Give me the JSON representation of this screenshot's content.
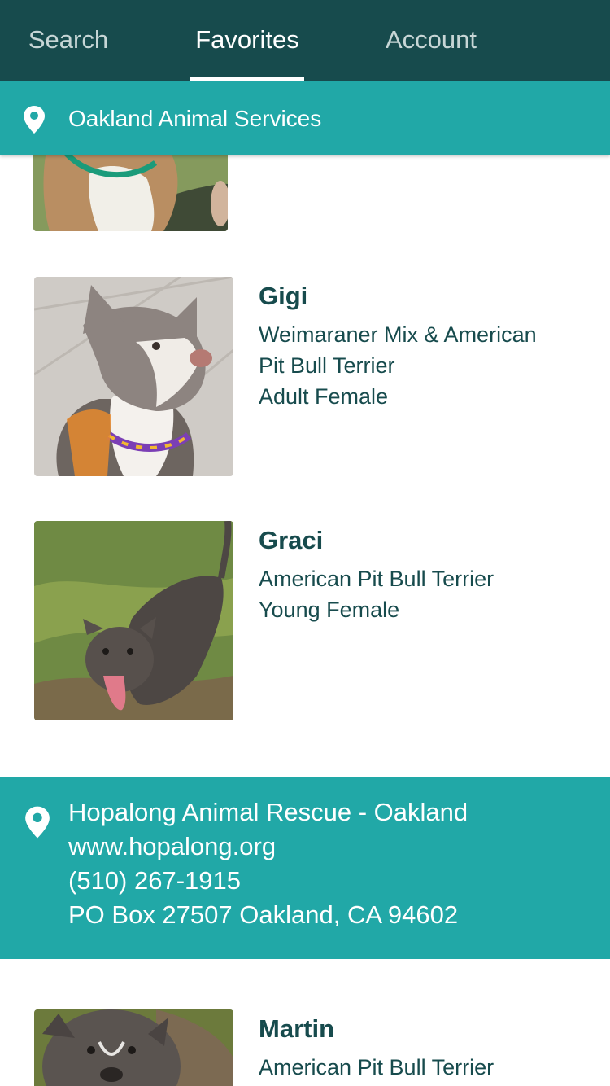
{
  "tabs": [
    {
      "label": "Search",
      "active": false
    },
    {
      "label": "Favorites",
      "active": true
    },
    {
      "label": "Account",
      "active": false
    }
  ],
  "current_shelter": {
    "name": "Oakland Animal Services",
    "icon": "map-pin-icon"
  },
  "pets_group_1": [
    {
      "name": "Gigi",
      "breed_line1": "Weimaraner Mix & American",
      "breed_line2": "Pit Bull Terrier",
      "age_sex": "Adult Female"
    },
    {
      "name": "Graci",
      "breed_line1": "American Pit Bull Terrier",
      "age_sex": "Young Female"
    }
  ],
  "shelter_2": {
    "icon": "map-pin-icon",
    "name": "Hopalong Animal Rescue - Oakland",
    "website": "www.hopalong.org",
    "phone": "(510) 267-1915",
    "address": "PO Box 27507 Oakland, CA 94602"
  },
  "pets_group_2": [
    {
      "name": "Martin",
      "breed_line1": "American Pit Bull Terrier"
    }
  ],
  "colors": {
    "header": "#174b4d",
    "teal": "#21a8a7",
    "text": "#174b4d"
  }
}
